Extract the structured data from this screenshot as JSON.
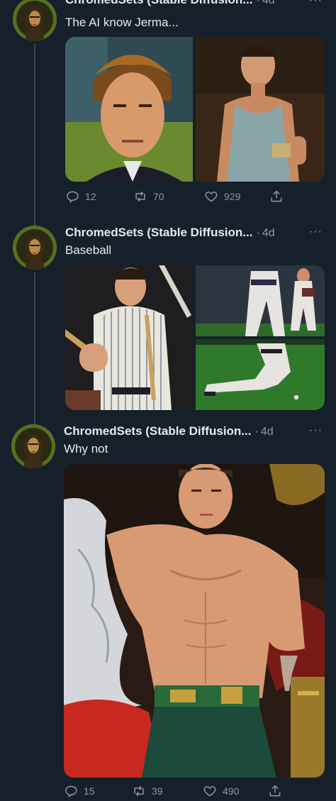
{
  "tweets": [
    {
      "author": "ChromedSets (Stable Diffusion...",
      "separator": "·",
      "time": "4d",
      "more": "···",
      "text": "The AI know Jerma...",
      "replies": "12",
      "retweets": "70",
      "likes": "929"
    },
    {
      "author": "ChromedSets (Stable Diffusion...",
      "separator": "·",
      "time": "4d",
      "more": "···",
      "text": "Baseball",
      "replies": "",
      "retweets": "",
      "likes": ""
    },
    {
      "author": "ChromedSets (Stable Diffusion...",
      "separator": "·",
      "time": "4d",
      "more": "···",
      "text": "Why not",
      "replies": "15",
      "retweets": "39",
      "likes": "490"
    }
  ],
  "icons": {
    "reply": "reply-icon",
    "retweet": "retweet-icon",
    "like": "heart-icon",
    "share": "share-icon"
  },
  "colors": {
    "background": "#15202b",
    "secondary_text": "#8b98a5",
    "primary_text": "#e7e9ea",
    "thread_line": "#38444d"
  }
}
